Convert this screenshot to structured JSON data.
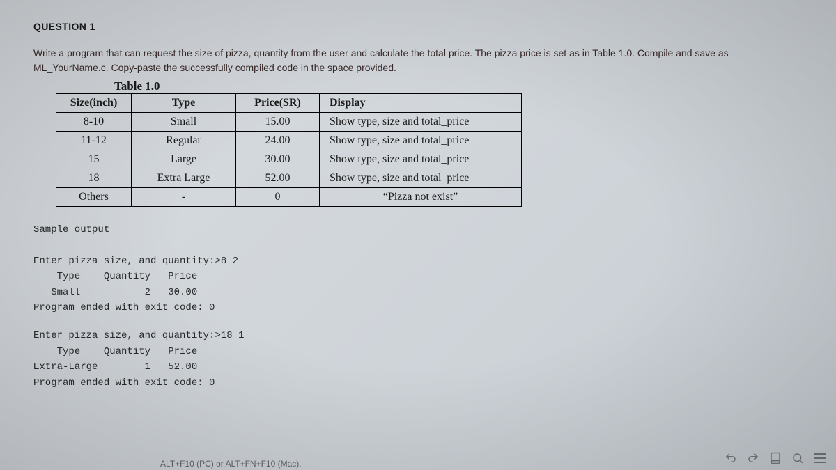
{
  "question_title": "QUESTION 1",
  "instruction": "Write a program that can request the size of pizza, quantity from the user and calculate the total price. The pizza price is set as in Table 1.0. Compile and save as ML_YourName.c. Copy-paste the successfully compiled code in the space provided.",
  "table_caption": "Table 1.0",
  "table": {
    "headers": {
      "size": "Size(inch)",
      "type": "Type",
      "price": "Price(SR)",
      "display": "Display"
    },
    "rows": [
      {
        "size": "8-10",
        "type": "Small",
        "price": "15.00",
        "display": "Show type, size and total_price"
      },
      {
        "size": "11-12",
        "type": "Regular",
        "price": "24.00",
        "display": "Show type, size and total_price"
      },
      {
        "size": "15",
        "type": "Large",
        "price": "30.00",
        "display": "Show type, size and total_price"
      },
      {
        "size": "18",
        "type": "Extra Large",
        "price": "52.00",
        "display": "Show type, size and total_price"
      },
      {
        "size": "Others",
        "type": "-",
        "price": "0",
        "display": "“Pizza not exist”"
      }
    ]
  },
  "sample_label": "Sample output",
  "sample_runs": [
    {
      "prompt": "Enter pizza size, and quantity:>8 2",
      "header": "    Type    Quantity   Price",
      "row": "   Small           2   30.00",
      "exit": "Program ended with exit code: 0"
    },
    {
      "prompt": "Enter pizza size, and quantity:>18 1",
      "header": "    Type    Quantity   Price",
      "row": "Extra-Large        1   52.00",
      "exit": "Program ended with exit code: 0"
    }
  ],
  "footer_hint": "ALT+F10 (PC) or ALT+FN+F10 (Mac)."
}
